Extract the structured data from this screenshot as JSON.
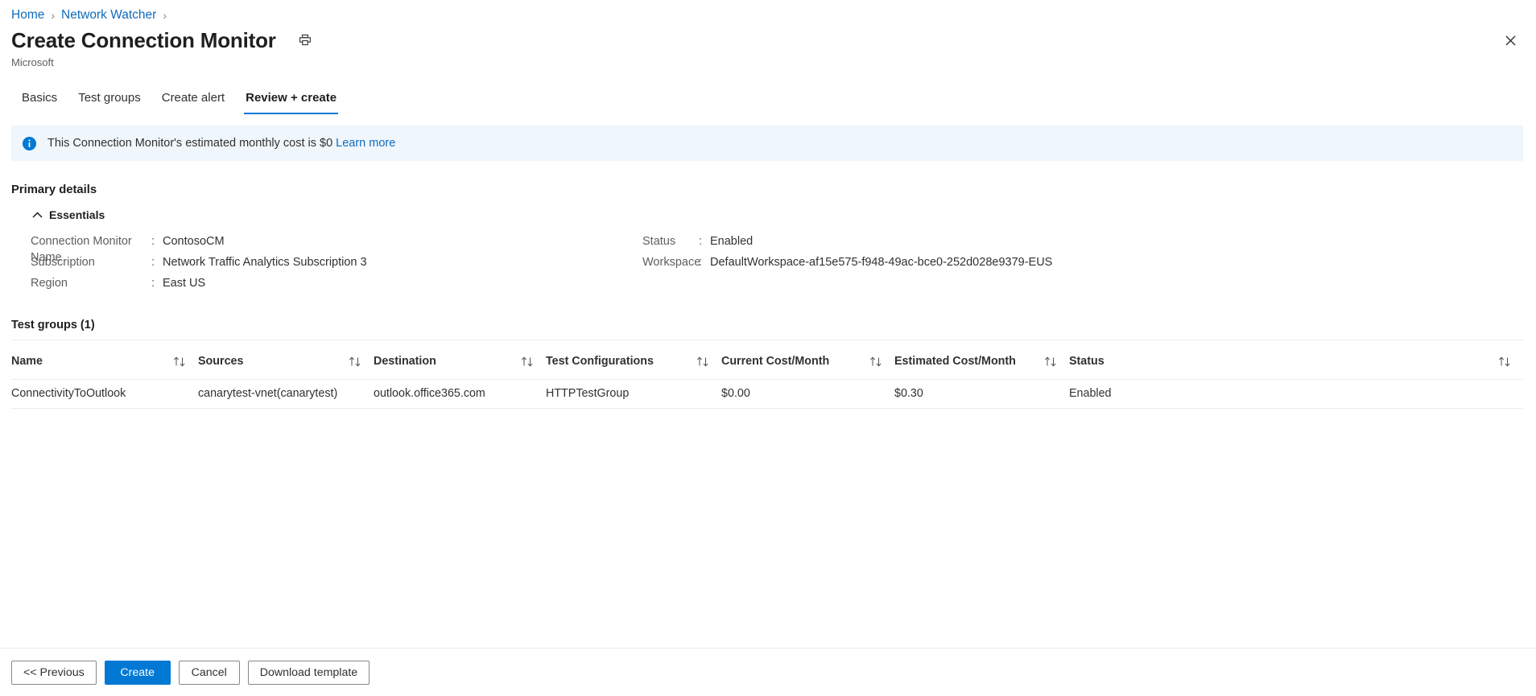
{
  "breadcrumb": {
    "items": [
      {
        "label": "Home"
      },
      {
        "label": "Network Watcher"
      }
    ],
    "separator": "›"
  },
  "header": {
    "title": "Create Connection Monitor",
    "subtitle": "Microsoft",
    "print_icon": "printer-icon",
    "close_icon": "close-icon"
  },
  "tabs": [
    {
      "label": "Basics",
      "active": false
    },
    {
      "label": "Test groups",
      "active": false
    },
    {
      "label": "Create alert",
      "active": false
    },
    {
      "label": "Review + create",
      "active": true
    }
  ],
  "banner": {
    "icon": "info-icon",
    "text": "This Connection Monitor's estimated monthly cost is $0",
    "link_label": "Learn more"
  },
  "primary_details": {
    "section_title": "Primary details",
    "essentials": {
      "label": "Essentials",
      "chevron_icon": "chevron-up-icon",
      "expanded": true,
      "left": [
        {
          "key": "Connection Monitor Name",
          "colon": ":",
          "value": "ContosoCM"
        },
        {
          "key": "Subscription",
          "colon": ":",
          "value": "Network Traffic Analytics Subscription 3"
        },
        {
          "key": "Region",
          "colon": ":",
          "value": "East US"
        }
      ],
      "right": [
        {
          "key": "Status",
          "colon": ":",
          "value": "Enabled"
        },
        {
          "key": "Workspace",
          "colon": ":",
          "value": "DefaultWorkspace-af15e575-f948-49ac-bce0-252d028e9379-EUS"
        }
      ]
    }
  },
  "test_groups": {
    "heading": "Test groups (1)",
    "sort_icon": "sort-updown-icon",
    "columns": [
      {
        "label": "Name"
      },
      {
        "label": "Sources"
      },
      {
        "label": "Destination"
      },
      {
        "label": "Test Configurations"
      },
      {
        "label": "Current Cost/Month"
      },
      {
        "label": "Estimated Cost/Month"
      },
      {
        "label": "Status"
      }
    ],
    "rows": [
      {
        "name": "ConnectivityToOutlook",
        "sources": "canarytest-vnet(canarytest)",
        "destination": "outlook.office365.com",
        "test_configurations": "HTTPTestGroup",
        "current_cost": "$0.00",
        "estimated_cost": "$0.30",
        "status": "Enabled"
      }
    ]
  },
  "footer": {
    "previous_label": "<< Previous",
    "create_label": "Create",
    "cancel_label": "Cancel",
    "download_label": "Download template"
  },
  "colors": {
    "accent": "#0078d4",
    "link": "#0f6cbd",
    "banner_bg": "#eff6fc",
    "rule": "#edebe9",
    "text": "#323130",
    "muted": "#605e5c"
  }
}
